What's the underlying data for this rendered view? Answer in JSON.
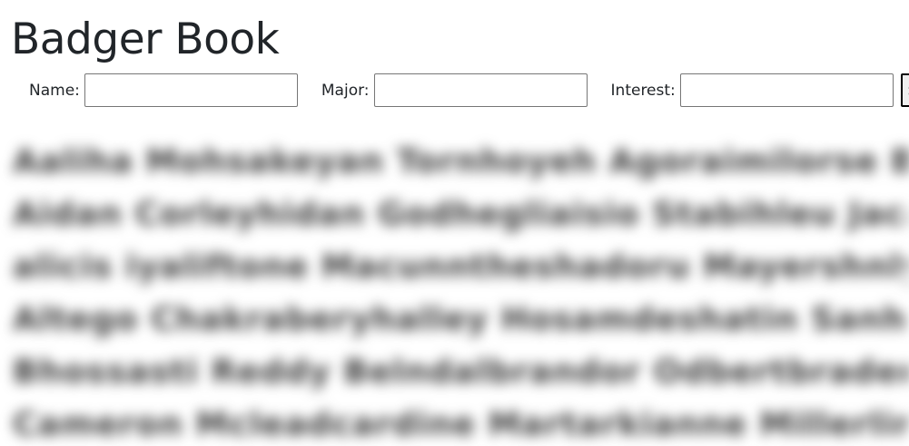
{
  "app": {
    "title": "Badger Book"
  },
  "search": {
    "name_label": "Name:",
    "name_value": "",
    "major_label": "Major:",
    "major_value": "",
    "interest_label": "Interest:",
    "interest_value": "",
    "button_label": "Search"
  },
  "results": {
    "lines": [
      "Aaliha Mohsakeyan Tornhoyeh Agoraimilorse Be",
      "Aidan Corleyhidan Godhegliaisio Stabihleu Jacalits Fo",
      "alicis iyaliftone Macunntheshadoru Mayershnly Lin",
      "Altego Chakraberyhalley Hosamdeshatin Sanhighdera",
      "Bhossasti Reddy Belndalbrandor Odbertbraden Tay",
      "Cameron Mcleadcardine Martarkianne Millerline Ta"
    ]
  }
}
